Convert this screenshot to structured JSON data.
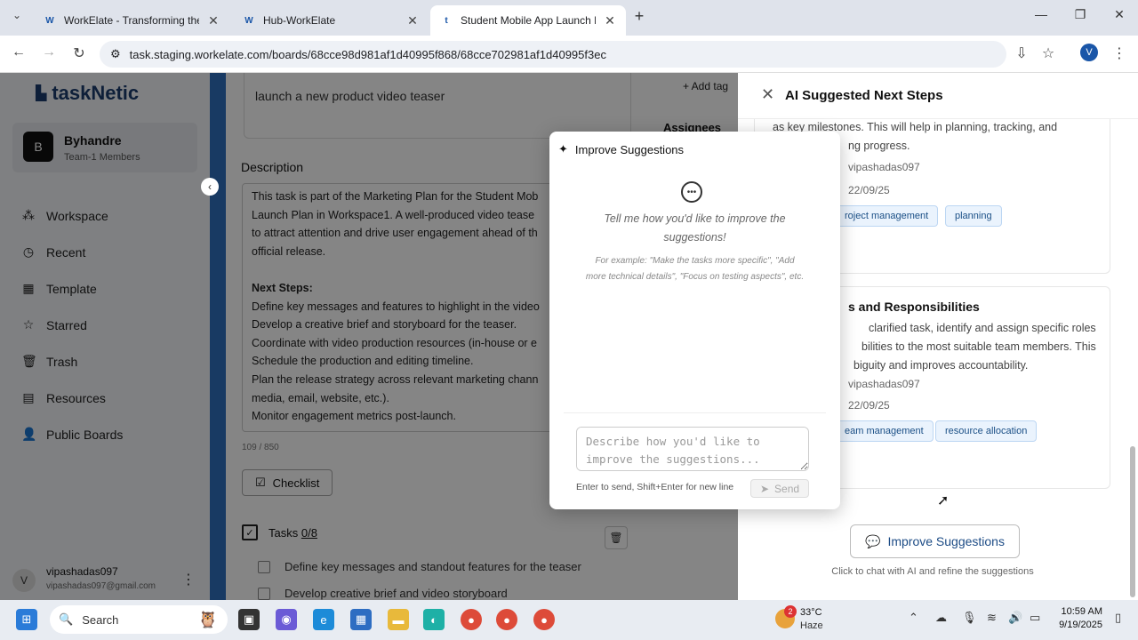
{
  "browser": {
    "tabs": [
      {
        "favicon": "W",
        "title": "WorkElate - Transforming the W"
      },
      {
        "favicon": "W",
        "title": "Hub-WorkElate"
      },
      {
        "favicon": "t",
        "title": "Student Mobile App Launch Pla"
      }
    ],
    "url": "task.staging.workelate.com/boards/68cce98d981af1d40995f868/68cce702981af1d40995f3ec",
    "profile_initial": "V"
  },
  "sidebar": {
    "logo": "taskNetic",
    "team": {
      "initial": "B",
      "name": "Byhandre",
      "members": "Team-1 Members"
    },
    "items": [
      {
        "icon": "workspace-icon",
        "glyph": "⁂",
        "label": "Workspace"
      },
      {
        "icon": "recent-icon",
        "glyph": "◷",
        "label": "Recent"
      },
      {
        "icon": "template-icon",
        "glyph": "▦",
        "label": "Template"
      },
      {
        "icon": "star-icon",
        "glyph": "☆",
        "label": "Starred"
      },
      {
        "icon": "trash-icon",
        "glyph": "🗑",
        "label": "Trash"
      },
      {
        "icon": "resources-icon",
        "glyph": "▤",
        "label": "Resources"
      },
      {
        "icon": "public-boards-icon",
        "glyph": "👤",
        "label": "Public Boards"
      }
    ],
    "user": {
      "initial": "V",
      "name": "vipashadas097",
      "email": "vipashadas097@gmail.com"
    }
  },
  "task": {
    "title": "launch a new product video teaser",
    "description_label": "Description",
    "description_lines": [
      "This task is part of the Marketing Plan for the Student Mob",
      "Launch Plan in Workspace1. A well-produced video tease",
      "to attract attention and drive user engagement ahead of th",
      "official release.",
      "",
      "Next Steps:",
      "Define key messages and features to highlight in the video",
      "Develop a creative brief and storyboard for the teaser.",
      "Coordinate with video production resources (in-house or e",
      "Schedule the production and editing timeline.",
      "Plan the release strategy across relevant marketing chann",
      "media, email, website, etc.).",
      "Monitor engagement metrics post-launch."
    ],
    "char_count": "109 / 850",
    "checklist_label": "Checklist",
    "tasks_label": "Tasks",
    "tasks_count": "0/8",
    "task_items": [
      "Define key messages and standout features for the teaser",
      "Develop creative brief and video storyboard"
    ],
    "add_tag": "+ Add tag",
    "assignees_label": "Assignees"
  },
  "ai_panel": {
    "title": "AI Suggested Next Steps",
    "card1": {
      "text_lines": [
        "as key milestones. This will help in planning, tracking, and",
        "ng progress."
      ],
      "user": "vipashadas097",
      "date": "22/09/25",
      "tags": [
        "roject management",
        "planning"
      ]
    },
    "card2": {
      "title": "s and Responsibilities",
      "text_lines": [
        "clarified task, identify and assign specific roles",
        "bilities to the most suitable team members. This",
        "biguity and improves accountability."
      ],
      "user": "vipashadas097",
      "date": "22/09/25",
      "tags": [
        "eam management",
        "resource allocation"
      ]
    },
    "improve_button": "Improve Suggestions",
    "improve_hint": "Click to chat with AI and refine the suggestions"
  },
  "modal": {
    "title": "Improve Suggestions",
    "prompt": "Tell me how you'd like to improve the suggestions!",
    "example": "For example: \"Make the tasks more specific\", \"Add more technical details\", \"Focus on testing aspects\", etc.",
    "input_placeholder": "Describe how you'd like to improve the suggestions...",
    "hint": "Enter to send, Shift+Enter for new line",
    "send_label": "Send"
  },
  "taskbar": {
    "search_label": "Search",
    "weather_temp": "33°C",
    "weather_cond": "Haze",
    "weather_badge": "2",
    "time": "10:59 AM",
    "date": "9/19/2025"
  },
  "colors": {
    "brand": "#1b3d6e",
    "accent": "#2f6fbf",
    "chip_bg": "#eaf3fd"
  }
}
